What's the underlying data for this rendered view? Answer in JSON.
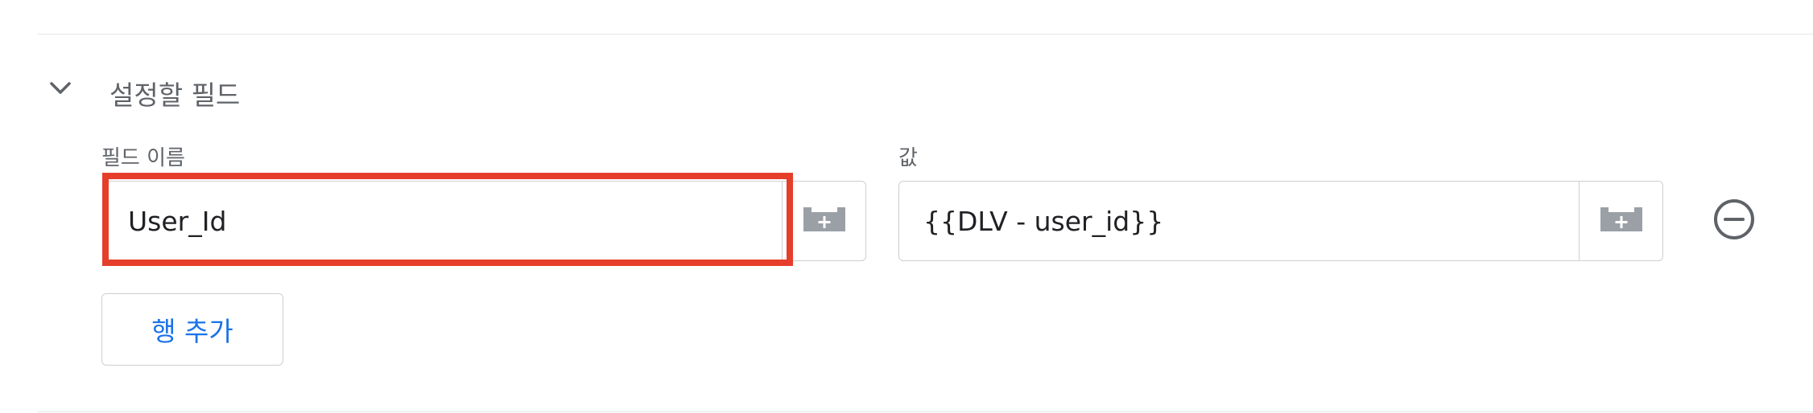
{
  "section": {
    "title": "설정할 필드",
    "toggle_icon": "chevron-down-icon"
  },
  "fields": {
    "name_label": "필드 이름",
    "value_label": "값",
    "row": {
      "name_value": "User_Id",
      "value_value": "{{DLV - user_id}}"
    },
    "variable_icon": "variable-brick-plus-icon",
    "remove_icon": "remove-circle-icon"
  },
  "actions": {
    "add_row_label": "행 추가"
  },
  "colors": {
    "accent": "#1a73e8",
    "highlight": "#e53e2a",
    "icon": "#9aa0a6",
    "muted_text": "#5f6368",
    "border": "#cfcfcf"
  }
}
